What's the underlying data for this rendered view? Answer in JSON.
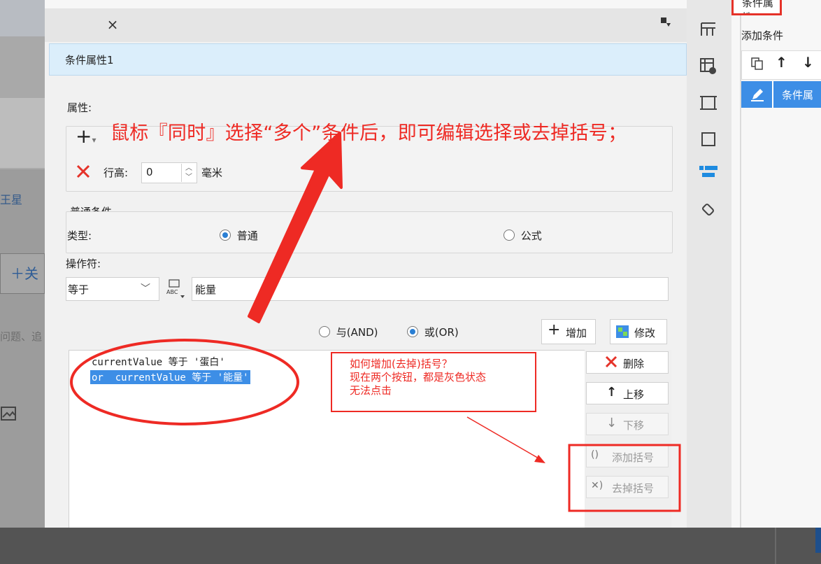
{
  "background_app": {
    "text_star": "王星",
    "button_add": "＋关",
    "text_hint": "问题、追"
  },
  "dialog": {
    "close_glyph": "×",
    "header_title": "条件属性1",
    "attr_section": {
      "label": "属性:",
      "add_glyph": "+",
      "row_height_label": "行高:",
      "row_height_value": "0",
      "row_height_unit": "毫米"
    },
    "normal_condition": {
      "title": "普通条件",
      "type_label": "类型:",
      "type_options": [
        "普通",
        "公式"
      ],
      "type_selected": "普通",
      "operator_label": "操作符:",
      "operator_value": "等于",
      "operand_value": "能量",
      "logic_options": [
        "与(AND)",
        "或(OR)"
      ],
      "logic_selected": "或(OR)",
      "add_label": "增加",
      "modify_label": "修改"
    },
    "conditions": [
      {
        "text": "currentValue 等于 '蛋白'",
        "selected": false
      },
      {
        "text": "or  currentValue 等于 '能量'",
        "selected": true
      }
    ],
    "side_buttons": {
      "delete": "删除",
      "move_up": "上移",
      "move_down": "下移",
      "add_bracket": "添加括号",
      "remove_bracket": "去掉括号"
    }
  },
  "right_panel": {
    "top_tab": "条件属性",
    "add_condition": "添加条件",
    "list_item": "条件属"
  },
  "annotations": {
    "headline": "鼠标『同时』选择“多个”条件后，即可编辑选择或去掉括号；",
    "note_lines": [
      "如何增加(去掉)括号？",
      "现在两个按钮，都是灰色状态",
      "无法点击"
    ]
  },
  "colors": {
    "annotation_red": "#ee2a24",
    "selection_blue": "#3d8ee6",
    "header_blue": "#dbeefb",
    "accent_blue": "#1e8be0"
  }
}
